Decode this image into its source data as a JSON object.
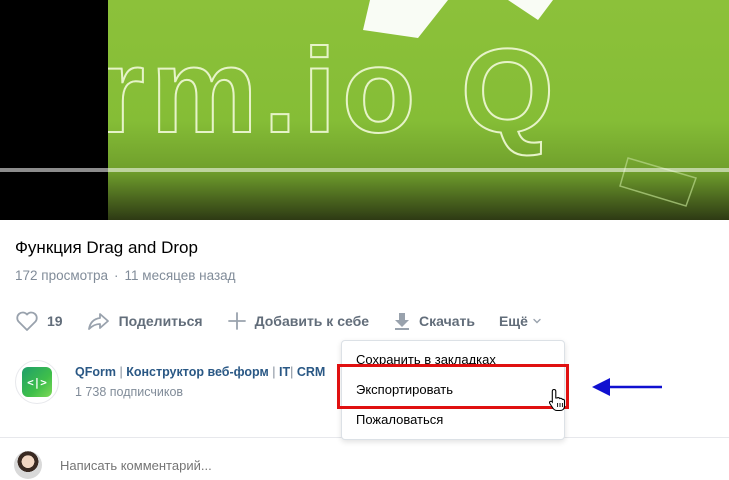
{
  "video": {
    "overlay_text": "rm.io Q",
    "background_color": "#8cc13a"
  },
  "post": {
    "title": "Функция Drag and Drop",
    "views": "172 просмотра",
    "time_ago": "11 месяцев назад"
  },
  "actions": {
    "like_count": "19",
    "share_label": "Поделиться",
    "add_label": "Добавить к себе",
    "download_label": "Скачать",
    "more_label": "Ещё"
  },
  "channel": {
    "logo_text": "<|>",
    "name_part1": "QForm",
    "name_sep1": " | ",
    "name_part2": "Конструктор веб-форм",
    "name_sep2": " | ",
    "name_part3": "IT",
    "name_sep3": "| ",
    "name_part4": "CRM",
    "subscribers": "1 738 подписчиков"
  },
  "menu": {
    "items": [
      {
        "label": "Сохранить в закладках"
      },
      {
        "label": "Экспортировать"
      },
      {
        "label": "Пожаловаться"
      }
    ]
  },
  "comment": {
    "placeholder": "Написать комментарий..."
  },
  "colors": {
    "accent_link": "#2a5885",
    "secondary_text": "#818c99",
    "highlight_box": "#e01010",
    "annotation_arrow": "#1010d0"
  }
}
